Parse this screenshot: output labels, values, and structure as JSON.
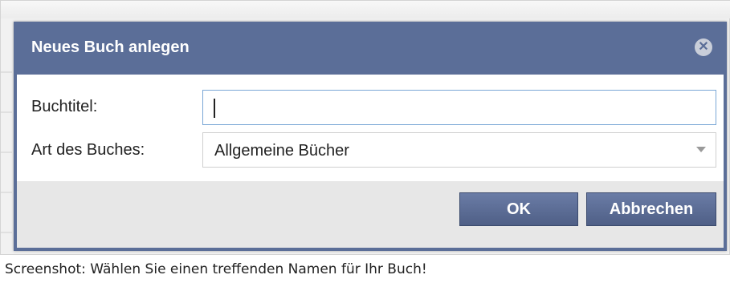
{
  "dialog": {
    "title": "Neues Buch anlegen",
    "close_icon": "close-icon",
    "fields": {
      "title_label": "Buchtitel:",
      "title_value": "",
      "type_label": "Art des Buches:",
      "type_value": "Allgemeine Bücher"
    },
    "buttons": {
      "ok_label": "OK",
      "cancel_label": "Abbrechen"
    },
    "colors": {
      "titlebar": "#5b6e98",
      "button": "#5b6e98",
      "input_focus_border": "#7aa7d6"
    }
  },
  "caption": "Screenshot: Wählen Sie einen treffenden Namen für Ihr Buch!"
}
